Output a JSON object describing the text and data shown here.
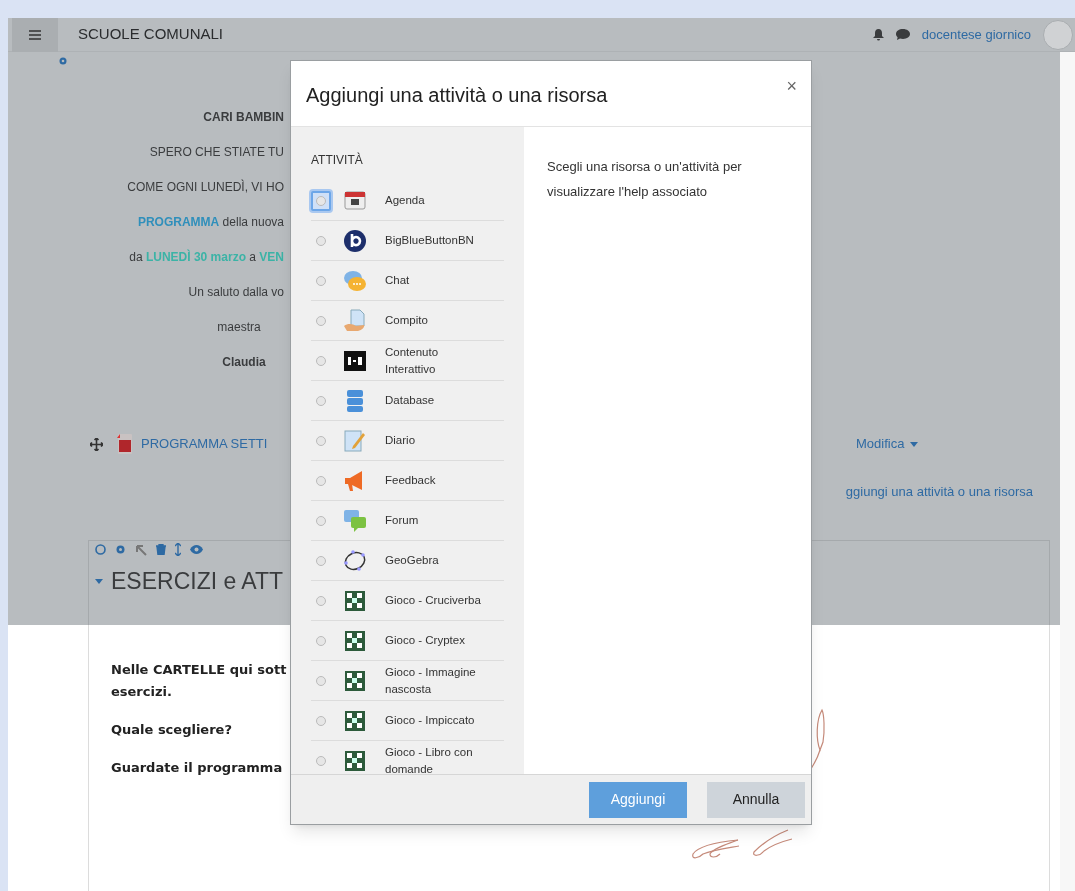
{
  "navbar": {
    "site_name": "SCUOLE COMUNALI",
    "user_name": "docentese giornico"
  },
  "page": {
    "intro_lines": [
      {
        "kind": "title",
        "text": "CARI BAMBIN"
      },
      {
        "kind": "plain",
        "text": "SPERO CHE STIATE TU"
      },
      {
        "kind": "plain",
        "text": "COME OGNI LUNEDÌ, VI HO"
      },
      {
        "kind": "plain",
        "text": "**PROGRAMMA** della nuova"
      },
      {
        "kind": "plain",
        "text": "da **LUNEDÌ 30 marzo** a **VEN**"
      },
      {
        "kind": "plain",
        "text": "Un saluto dalla vo"
      },
      {
        "kind": "signature",
        "text": "maestra"
      },
      {
        "kind": "signature_bold",
        "text": "Claudia"
      }
    ],
    "resource_link": "PROGRAMMA SETTI",
    "edit_menu": "Modifica",
    "add_link": "ggiungi una attività o una risorsa",
    "section_title": "ESERCIZI e ATT",
    "section_lines": [
      "Nelle CARTELLE qui sott",
      "esercizi.",
      "Quale scegliere?",
      "Guardate il programma"
    ]
  },
  "modal": {
    "title": "Aggiungi una attività o una risorsa",
    "close": "×",
    "list_heading": "ATTIVITÀ",
    "items": [
      {
        "kind": "calendar",
        "label": "Agenda",
        "selected": false,
        "focused": true
      },
      {
        "kind": "bbb",
        "label": "BigBlueButtonBN",
        "selected": false,
        "focused": false
      },
      {
        "kind": "chat",
        "label": "Chat",
        "selected": false,
        "focused": false
      },
      {
        "kind": "assignment",
        "label": "Compito",
        "selected": false,
        "focused": false
      },
      {
        "kind": "h5p",
        "label": "Contenuto Interattivo",
        "selected": false,
        "focused": false
      },
      {
        "kind": "database",
        "label": "Database",
        "selected": false,
        "focused": false
      },
      {
        "kind": "journal",
        "label": "Diario",
        "selected": false,
        "focused": false
      },
      {
        "kind": "feedback",
        "label": "Feedback",
        "selected": false,
        "focused": false
      },
      {
        "kind": "forum",
        "label": "Forum",
        "selected": false,
        "focused": false
      },
      {
        "kind": "geogebra",
        "label": "GeoGebra",
        "selected": false,
        "focused": false
      },
      {
        "kind": "game",
        "label": "Gioco - Cruciverba",
        "selected": false,
        "focused": false
      },
      {
        "kind": "game",
        "label": "Gioco - Cryptex",
        "selected": false,
        "focused": false
      },
      {
        "kind": "game",
        "label": "Gioco - Immagine nascosta",
        "selected": false,
        "focused": false
      },
      {
        "kind": "game",
        "label": "Gioco - Impiccato",
        "selected": false,
        "focused": false
      },
      {
        "kind": "game",
        "label": "Gioco - Libro con domande",
        "selected": false,
        "focused": false
      }
    ],
    "help_text": "Scegli una risorsa o un'attività per visualizzare l'help associato",
    "buttons": [
      {
        "kind": "primary",
        "label": "Aggiungi"
      },
      {
        "kind": "secondary",
        "label": "Annulla"
      }
    ]
  }
}
